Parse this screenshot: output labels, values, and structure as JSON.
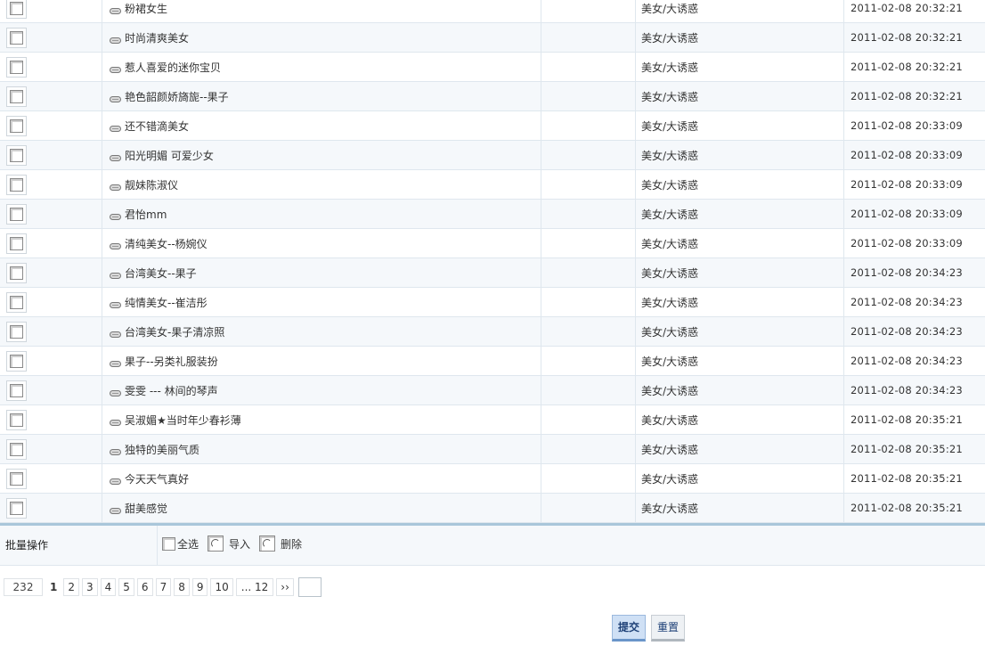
{
  "rows": [
    {
      "title": "粉裙女生",
      "category": "美女/大诱惑",
      "time": "2011-02-08 20:32:21"
    },
    {
      "title": "时尚清爽美女",
      "category": "美女/大诱惑",
      "time": "2011-02-08 20:32:21"
    },
    {
      "title": "惹人喜爱的迷你宝贝",
      "category": "美女/大诱惑",
      "time": "2011-02-08 20:32:21"
    },
    {
      "title": "艳色韶颜娇旖旎--果子",
      "category": "美女/大诱惑",
      "time": "2011-02-08 20:32:21"
    },
    {
      "title": "还不错滴美女",
      "category": "美女/大诱惑",
      "time": "2011-02-08 20:33:09"
    },
    {
      "title": "阳光明媚 可爱少女",
      "category": "美女/大诱惑",
      "time": "2011-02-08 20:33:09"
    },
    {
      "title": "靓妹陈淑仪",
      "category": "美女/大诱惑",
      "time": "2011-02-08 20:33:09"
    },
    {
      "title": "君怡mm",
      "category": "美女/大诱惑",
      "time": "2011-02-08 20:33:09"
    },
    {
      "title": "清纯美女--杨婉仪",
      "category": "美女/大诱惑",
      "time": "2011-02-08 20:33:09"
    },
    {
      "title": "台湾美女--果子",
      "category": "美女/大诱惑",
      "time": "2011-02-08 20:34:23"
    },
    {
      "title": "纯情美女--崔洁彤",
      "category": "美女/大诱惑",
      "time": "2011-02-08 20:34:23"
    },
    {
      "title": "台湾美女-果子清凉照",
      "category": "美女/大诱惑",
      "time": "2011-02-08 20:34:23"
    },
    {
      "title": "果子--另类礼服装扮",
      "category": "美女/大诱惑",
      "time": "2011-02-08 20:34:23"
    },
    {
      "title": "雯雯 --- 林间的琴声",
      "category": "美女/大诱惑",
      "time": "2011-02-08 20:34:23"
    },
    {
      "title": "吴淑媚★当时年少春衫薄",
      "category": "美女/大诱惑",
      "time": "2011-02-08 20:35:21"
    },
    {
      "title": "独特的美丽气质",
      "category": "美女/大诱惑",
      "time": "2011-02-08 20:35:21"
    },
    {
      "title": "今天天气真好",
      "category": "美女/大诱惑",
      "time": "2011-02-08 20:35:21"
    },
    {
      "title": "甜美感觉",
      "category": "美女/大诱惑",
      "time": "2011-02-08 20:35:21"
    }
  ],
  "batch": {
    "label": "批量操作",
    "select_all": "全选",
    "import": "导入",
    "delete": "删除"
  },
  "pager": {
    "total": "232",
    "current": "1",
    "pages": [
      "2",
      "3",
      "4",
      "5",
      "6",
      "7",
      "8",
      "9",
      "10"
    ],
    "last": "... 12",
    "next": "››"
  },
  "buttons": {
    "submit": "提交",
    "reset": "重置"
  },
  "colors": {
    "row_alt": "#f5f8fb",
    "border": "#dfe7ee",
    "batch_top": "#a9c6da",
    "submit_bg": "#cfe0f5"
  }
}
